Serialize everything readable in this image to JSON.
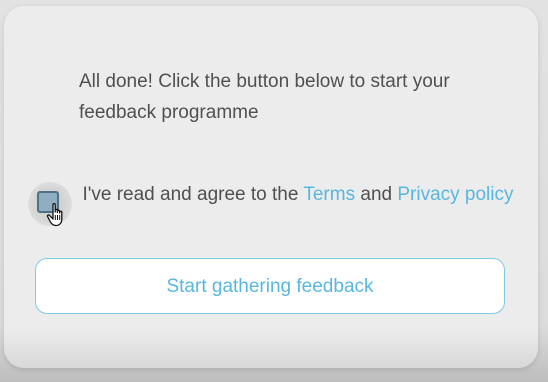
{
  "completion_message": "All done! Click the button below to start your feedback programme",
  "consent": {
    "checked": true,
    "prefix": "I've read and agree to the ",
    "terms_link": "Terms",
    "conjunction": " and ",
    "privacy_link": "Privacy policy"
  },
  "cta": {
    "label": "Start gathering feedback"
  },
  "colors": {
    "link": "#58b7de",
    "text": "#505050",
    "button_border": "#7fc9e6",
    "card_background": "#ececec"
  },
  "icons": {
    "cursor": "hand-pointer-icon"
  }
}
